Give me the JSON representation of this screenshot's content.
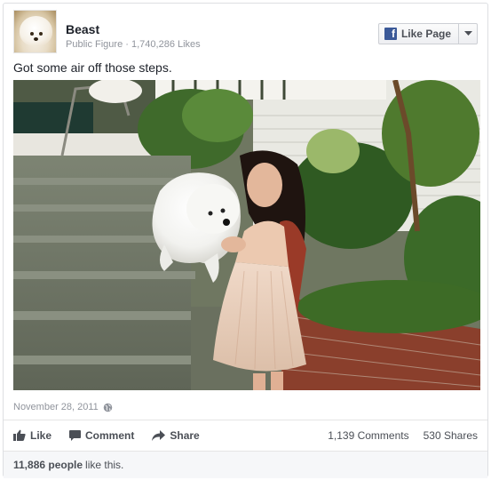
{
  "post": {
    "page_name": "Beast",
    "page_category": "Public Figure",
    "page_likes": "1,740,286 Likes",
    "like_page_label": "Like Page",
    "caption": "Got some air off those steps.",
    "timestamp": "November 28, 2011"
  },
  "actions": {
    "like": "Like",
    "comment": "Comment",
    "share": "Share"
  },
  "stats": {
    "comments": "1,139 Comments",
    "shares": "530 Shares",
    "likes_count": "11,886 people",
    "likes_suffix": "like this."
  },
  "icons": {
    "facebook": "facebook-f-icon",
    "dropdown": "chevron-down-icon",
    "globe": "globe-icon",
    "like": "thumbs-up-icon",
    "comment": "speech-bubble-icon",
    "share": "share-arrow-icon"
  },
  "colors": {
    "brand": "#3b5998",
    "muted_text": "#90949c",
    "action_text": "#4b4f56"
  }
}
